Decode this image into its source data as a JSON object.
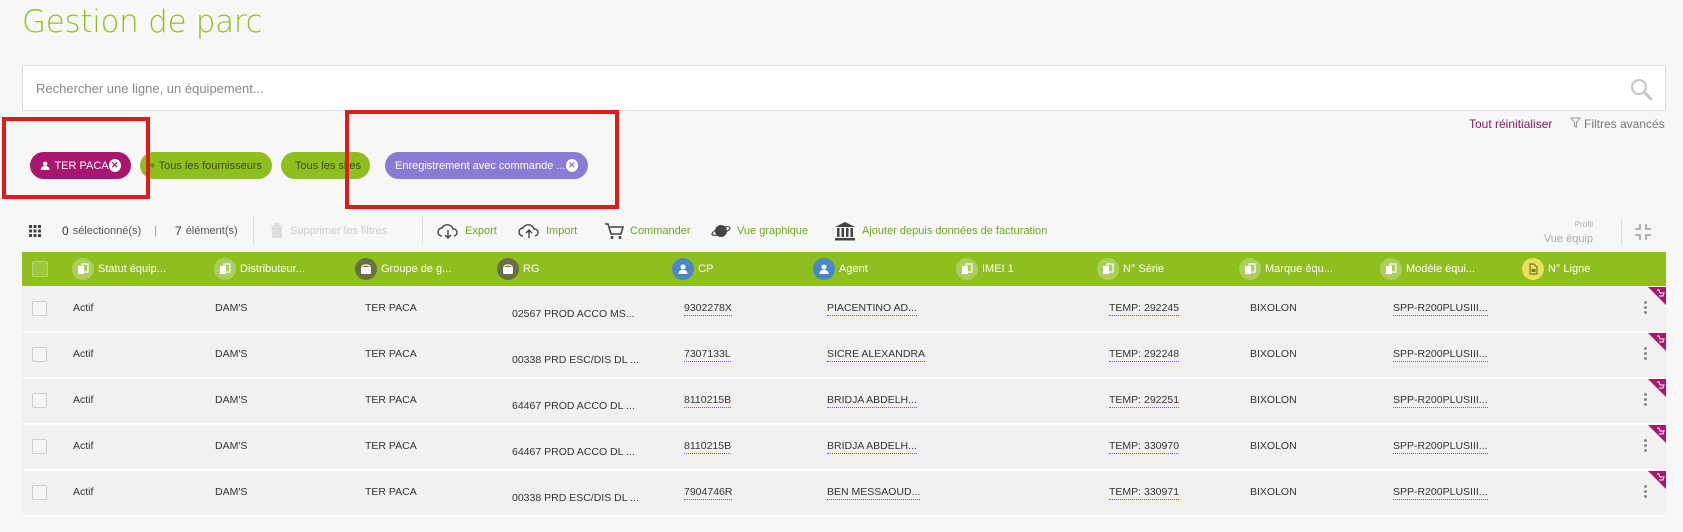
{
  "page": {
    "title": "Gestion de parc"
  },
  "search": {
    "placeholder": "Rechercher une ligne, un équipement..."
  },
  "filters_bar": {
    "reset_label": "Tout réinitialiser",
    "advanced_label": "Filtres avancés"
  },
  "chips": [
    {
      "label": "TER PACA",
      "removable": true,
      "color": "#a8166f"
    },
    {
      "label": "Tous les fournisseurs",
      "removable": false,
      "color": "#8fbf1f"
    },
    {
      "label": "Tous les sites",
      "removable": false,
      "color": "#8fbf1f"
    },
    {
      "label": "Enregistrement avec commande ...",
      "removable": true,
      "color": "#8b7bd6"
    }
  ],
  "toolbar": {
    "selected_count": "0",
    "selected_label": "sélectionné(s)",
    "separator": "|",
    "element_count": "7",
    "element_label": "élément(s)",
    "delete_filters": "Supprimer les filtres",
    "export": "Export",
    "import": "Import",
    "order": "Commander",
    "graph_view": "Vue graphique",
    "billing": "Ajouter depuis données de facturation",
    "profile_label": "Profil",
    "profile_value": "Vue équip"
  },
  "table": {
    "columns": [
      "Statut équip...",
      "Distributeur...",
      "Groupe de g...",
      "RG",
      "CP",
      "Agent",
      "IMEI 1",
      "N° Série",
      "Marque équ...",
      "Modèle équi...",
      "N° Ligne"
    ],
    "rows": [
      {
        "statut": "Actif",
        "distributeur": "DAM'S",
        "groupe": "TER PACA",
        "rg": "02567 PROD ACCO MS...",
        "cp": "9302278X",
        "agent": "PIACENTINO AD...",
        "imei": "",
        "serie": "TEMP: 292245",
        "marque": "BIXOLON",
        "modele": "SPP-R200PLUSIII...",
        "ligne": ""
      },
      {
        "statut": "Actif",
        "distributeur": "DAM'S",
        "groupe": "TER PACA",
        "rg": "00338 PRD ESC/DIS DL ...",
        "cp": "7307133L",
        "agent": "SICRE ALEXANDRA",
        "imei": "",
        "serie": "TEMP: 292248",
        "marque": "BIXOLON",
        "modele": "SPP-R200PLUSIII...",
        "ligne": ""
      },
      {
        "statut": "Actif",
        "distributeur": "DAM'S",
        "groupe": "TER PACA",
        "rg": "64467 PROD ACCO DL ...",
        "cp": "8110215B",
        "agent": "BRIDJA ABDELH...",
        "imei": "",
        "serie": "TEMP: 292251",
        "marque": "BIXOLON",
        "modele": "SPP-R200PLUSIII...",
        "ligne": ""
      },
      {
        "statut": "Actif",
        "distributeur": "DAM'S",
        "groupe": "TER PACA",
        "rg": "64467 PROD ACCO DL ...",
        "cp": "8110215B",
        "agent": "BRIDJA ABDELH...",
        "imei": "",
        "serie": "TEMP: 330970",
        "marque": "BIXOLON",
        "modele": "SPP-R200PLUSIII...",
        "ligne": ""
      },
      {
        "statut": "Actif",
        "distributeur": "DAM'S",
        "groupe": "TER PACA",
        "rg": "00338 PRD ESC/DIS DL ...",
        "cp": "7904746R",
        "agent": "BEN MESSAOUD...",
        "imei": "",
        "serie": "TEMP: 330971",
        "marque": "BIXOLON",
        "modele": "SPP-R200PLUSIII...",
        "ligne": ""
      }
    ]
  },
  "colors": {
    "brand_green": "#8fbf1f",
    "brand_magenta": "#a8166f",
    "chip_purple": "#8b7bd6",
    "highlight_red": "#e01b1b"
  }
}
